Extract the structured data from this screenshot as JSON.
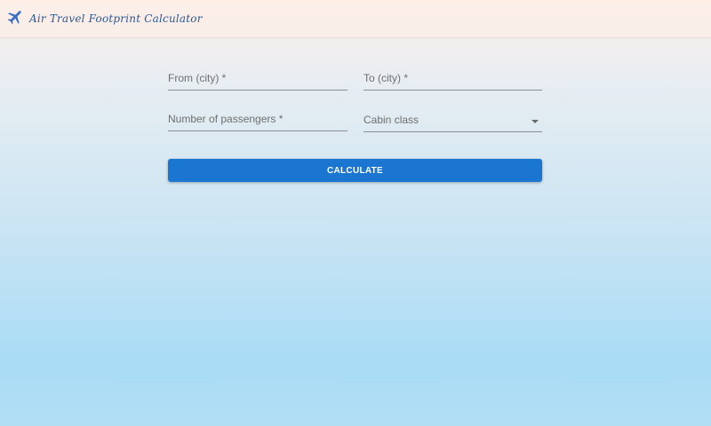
{
  "header": {
    "title": "Air Travel Footprint Calculator",
    "logo_icon": "airplane-icon"
  },
  "form": {
    "from_label": "From (city) *",
    "to_label": "To (city) *",
    "passengers_label": "Number of passengers *",
    "cabin_label": "Cabin class",
    "cabin_icon": "chevron-down-icon",
    "calculate_label": "CALCULATE"
  },
  "colors": {
    "accent": "#1b76d2",
    "title": "#2a5a9a"
  }
}
